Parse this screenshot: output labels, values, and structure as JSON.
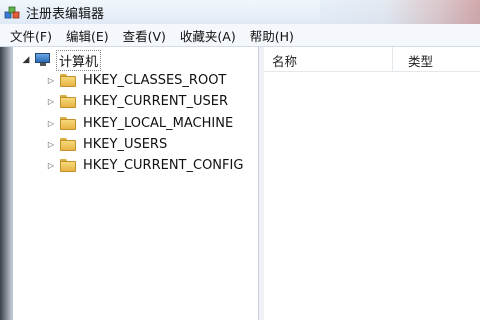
{
  "window": {
    "title": "注册表编辑器"
  },
  "menu": [
    "文件(F)",
    "编辑(E)",
    "查看(V)",
    "收藏夹(A)",
    "帮助(H)"
  ],
  "tree": {
    "root": "计算机",
    "nodes": [
      "HKEY_CLASSES_ROOT",
      "HKEY_CURRENT_USER",
      "HKEY_LOCAL_MACHINE",
      "HKEY_USERS",
      "HKEY_CURRENT_CONFIG"
    ]
  },
  "list": {
    "columns": [
      "名称",
      "类型"
    ]
  }
}
